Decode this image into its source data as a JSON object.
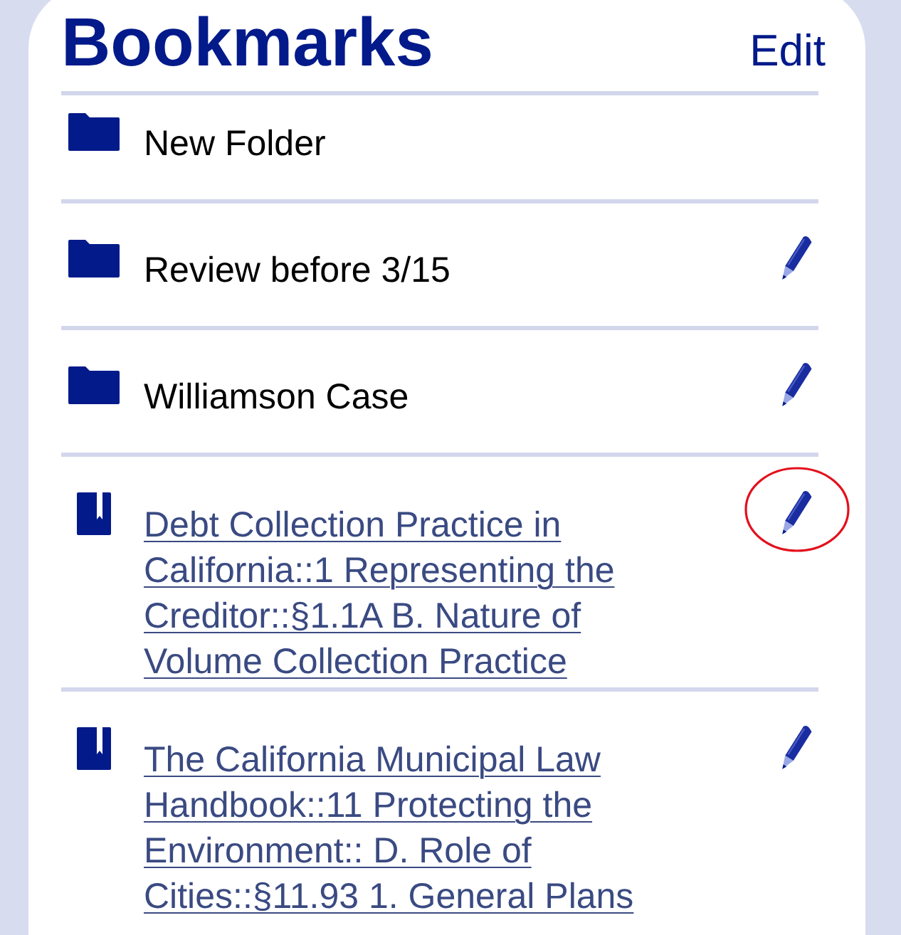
{
  "header": {
    "title": "Bookmarks",
    "edit_label": "Edit"
  },
  "items": [
    {
      "kind": "folder",
      "label": "New Folder",
      "editable": false,
      "circled": false
    },
    {
      "kind": "folder",
      "label": "Review before 3/15",
      "editable": true,
      "circled": false
    },
    {
      "kind": "folder",
      "label": "Williamson Case",
      "editable": true,
      "circled": false
    },
    {
      "kind": "bookmark",
      "label": "Debt Collection Practice in California::1 Representing the Creditor::§1.1A B. Nature of Volume Collection Practice",
      "editable": true,
      "circled": true
    },
    {
      "kind": "bookmark",
      "label": "The California Municipal Law Handbook::11 Protecting the Environment:: D. Role of Cities::§11.93 1. General Plans",
      "editable": true,
      "circled": false
    }
  ]
}
